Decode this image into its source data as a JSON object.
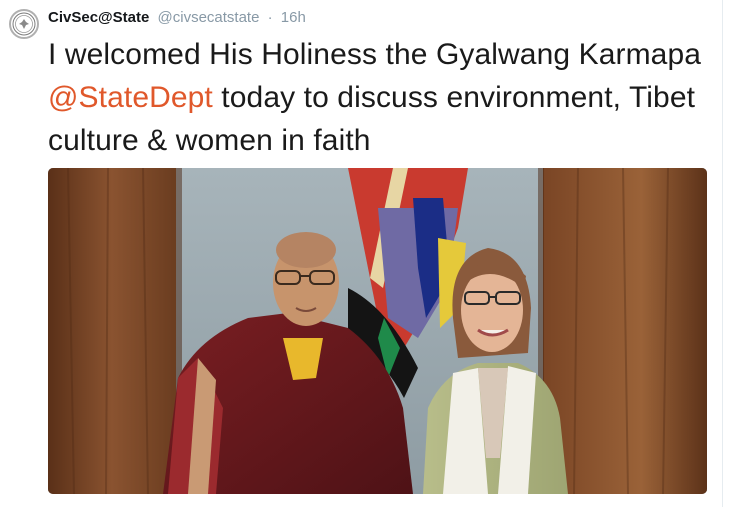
{
  "tweet": {
    "author_name": "CivSec@State",
    "handle": "@civsecatstate",
    "separator": "·",
    "timestamp": "16h",
    "text_before": "I welcomed His Holiness the Gyalwang Karmapa ",
    "mention": "@StateDept",
    "text_after": " today to discuss environment, Tibet culture & women in faith",
    "avatar_icon": "state-seal-icon",
    "colors": {
      "mention": "#e0582b",
      "meta": "#8899a6",
      "text": "#1a1a1a"
    }
  }
}
